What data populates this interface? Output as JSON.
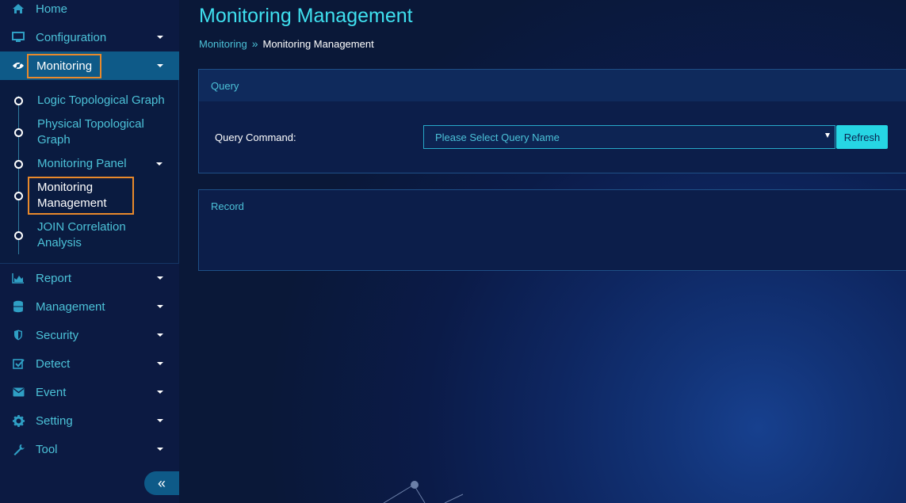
{
  "sidebar": {
    "items": [
      {
        "label": "Home",
        "icon": "home-icon"
      },
      {
        "label": "Configuration",
        "icon": "monitor-icon"
      },
      {
        "label": "Monitoring",
        "icon": "eye-icon"
      },
      {
        "label": "Report",
        "icon": "area-chart-icon"
      },
      {
        "label": "Management",
        "icon": "database-icon"
      },
      {
        "label": "Security",
        "icon": "shield-icon"
      },
      {
        "label": "Detect",
        "icon": "check-square-icon"
      },
      {
        "label": "Event",
        "icon": "envelope-icon"
      },
      {
        "label": "Setting",
        "icon": "gear-icon"
      },
      {
        "label": "Tool",
        "icon": "wrench-icon"
      }
    ],
    "submenu": [
      {
        "label": "Logic Topological Graph"
      },
      {
        "label": "Physical Topological Graph"
      },
      {
        "label": "Monitoring Panel"
      },
      {
        "label": "Monitoring Management"
      },
      {
        "label": "JOIN Correlation Analysis"
      }
    ],
    "collapse_icon": "«"
  },
  "page": {
    "title": "Monitoring Management",
    "breadcrumb": {
      "parent": "Monitoring",
      "separator": "»",
      "current": "Monitoring Management"
    }
  },
  "query": {
    "header": "Query",
    "command_label": "Query Command:",
    "select_placeholder": "Please Select Query Name",
    "refresh_label": "Refresh"
  },
  "record": {
    "header": "Record"
  },
  "colors": {
    "accent": "#3fe0ef",
    "highlight_border": "#e8892b",
    "active_bg": "#0e5a88",
    "button_bg": "#26d6e4"
  }
}
